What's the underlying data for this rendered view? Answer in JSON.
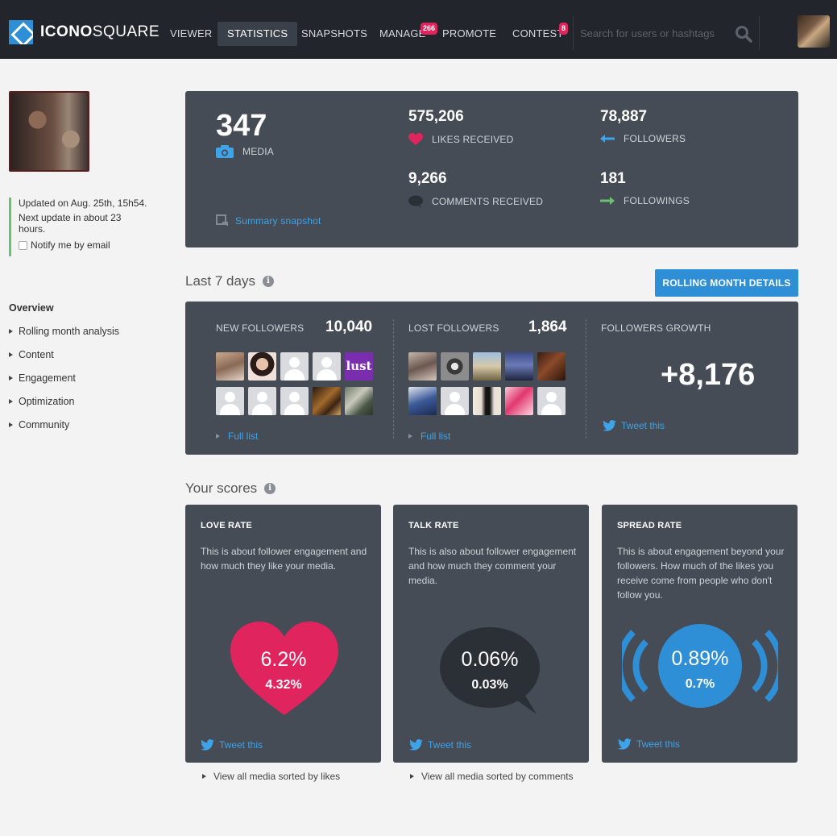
{
  "header": {
    "brand_bold": "ICONO",
    "brand_light": "SQUARE",
    "nav": [
      {
        "label": "VIEWER"
      },
      {
        "label": "STATISTICS",
        "active": true
      },
      {
        "label": "SNAPSHOTS"
      },
      {
        "label": "MANAGE",
        "badge": "266"
      },
      {
        "label": "PROMOTE"
      },
      {
        "label": "CONTEST",
        "badge": "8"
      }
    ],
    "search_placeholder": "Search for users or hashtags"
  },
  "sidebar": {
    "updated": "Updated on Aug. 25th, 15h54.",
    "next_update": "Next update in about 23",
    "next_update_2": "hours.",
    "notify_label": "Notify me by email",
    "notify_checked": false,
    "items": [
      {
        "label": "Overview",
        "active": true
      },
      {
        "label": "Rolling month analysis"
      },
      {
        "label": "Content"
      },
      {
        "label": "Engagement"
      },
      {
        "label": "Optimization"
      },
      {
        "label": "Community"
      }
    ]
  },
  "summary": {
    "media_count": "347",
    "media_label": "MEDIA",
    "likes_count": "575,206",
    "likes_label": "LIKES RECEIVED",
    "followers_count": "78,887",
    "followers_label": "FOLLOWERS",
    "comments_count": "9,266",
    "comments_label": "COMMENTS RECEIVED",
    "followings_count": "181",
    "followings_label": "FOLLOWINGS",
    "snapshot_link": "Summary snapshot"
  },
  "last7": {
    "title": "Last 7 days",
    "rolling_button": "ROLLING MONTH DETAILS",
    "new_followers_label": "NEW FOLLOWERS",
    "new_followers_count": "10,040",
    "lost_followers_label": "LOST FOLLOWERS",
    "lost_followers_count": "1,864",
    "growth_label": "FOLLOWERS GROWTH",
    "growth_value": "+8,176",
    "full_list": "Full list",
    "tweet": "Tweet this",
    "new_thumb_text": "lust"
  },
  "scores": {
    "title": "Your scores",
    "cards": [
      {
        "title": "LOVE RATE",
        "desc": "This is about follower engagement and how much they like your media.",
        "main": "6.2%",
        "sub": "4.32%",
        "tweet": "Tweet this",
        "view_all": "View all media sorted by likes",
        "color": "#e0245e"
      },
      {
        "title": "TALK RATE",
        "desc": "This is also about follower engagement and how much they comment your media.",
        "main": "0.06%",
        "sub": "0.03%",
        "tweet": "Tweet this",
        "view_all": "View all media sorted by comments",
        "color": "#2b3036"
      },
      {
        "title": "SPREAD RATE",
        "desc": "This is about engagement beyond your followers. How much of the likes you receive come from people who don't follow you.",
        "main": "0.89%",
        "sub": "0.7%",
        "tweet": "Tweet this",
        "color": "#2e8ed6"
      }
    ]
  },
  "colors": {
    "nav_bg": "#22262c",
    "card_bg": "#454c56",
    "accent_blue": "#2e8ed6",
    "link_blue": "#3ea3e8",
    "love_red": "#e0245e",
    "update_green": "#6cc070"
  }
}
